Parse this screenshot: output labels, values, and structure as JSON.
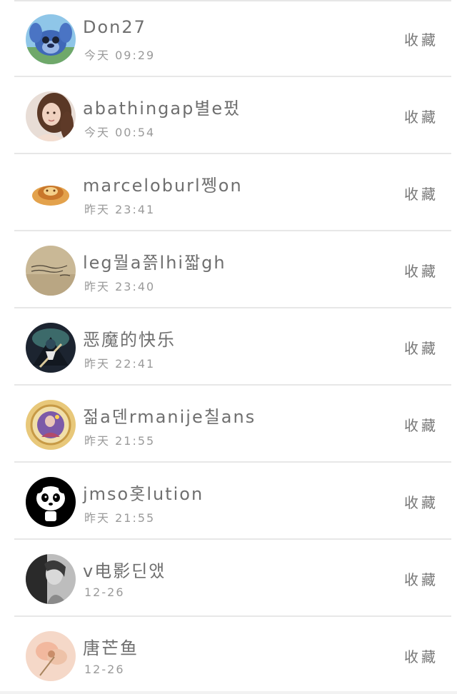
{
  "action_label": "收藏",
  "items": [
    {
      "name": "Don27",
      "time": "今天 09:29",
      "avatar": "blue-creature-avatar"
    },
    {
      "name": "abathingap별e펐",
      "time": "今天 00:54",
      "avatar": "woman-portrait-avatar"
    },
    {
      "name": "marceloburl쩽on",
      "time": "昨天 23:41",
      "avatar": "orange-food-avatar"
    },
    {
      "name": "leg뭘a쯝lhi짧gh",
      "time": "昨天 23:40",
      "avatar": "handwritten-note-avatar"
    },
    {
      "name": "恶魔的快乐",
      "time": "昨天 22:41",
      "avatar": "dark-artwork-avatar"
    },
    {
      "name": "젊a덴rmanije칠ans",
      "time": "昨天 21:55",
      "avatar": "purple-badge-avatar"
    },
    {
      "name": "jmso홋lution",
      "time": "昨天 21:55",
      "avatar": "panda-avatar"
    },
    {
      "name": "v电影딘앴",
      "time": "12-26",
      "avatar": "bw-portrait-avatar"
    },
    {
      "name": "唐芒鱼",
      "time": "12-26",
      "avatar": "flower-avatar"
    }
  ]
}
